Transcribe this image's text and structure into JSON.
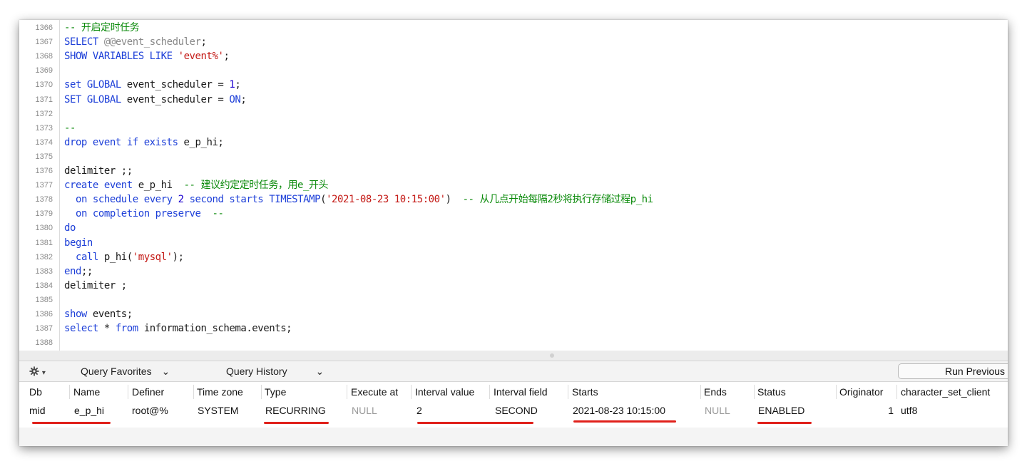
{
  "editor": {
    "lines": [
      {
        "n": "1366",
        "segs": [
          {
            "t": "-- 开启定时任务",
            "c": "cm"
          }
        ]
      },
      {
        "n": "1367",
        "segs": [
          {
            "t": "SELECT",
            "c": "kw"
          },
          {
            "t": " "
          },
          {
            "t": "@@event_scheduler",
            "c": "var"
          },
          {
            "t": ";"
          }
        ]
      },
      {
        "n": "1368",
        "segs": [
          {
            "t": "SHOW VARIABLES LIKE",
            "c": "kw"
          },
          {
            "t": " "
          },
          {
            "t": "'event%'",
            "c": "str"
          },
          {
            "t": ";"
          }
        ]
      },
      {
        "n": "1369",
        "segs": []
      },
      {
        "n": "1370",
        "segs": [
          {
            "t": "set",
            "c": "kw"
          },
          {
            "t": " "
          },
          {
            "t": "GLOBAL",
            "c": "kw"
          },
          {
            "t": " event_scheduler = "
          },
          {
            "t": "1",
            "c": "num"
          },
          {
            "t": ";"
          }
        ]
      },
      {
        "n": "1371",
        "segs": [
          {
            "t": "SET",
            "c": "kw"
          },
          {
            "t": " "
          },
          {
            "t": "GLOBAL",
            "c": "kw"
          },
          {
            "t": " event_scheduler = "
          },
          {
            "t": "ON",
            "c": "kw"
          },
          {
            "t": ";"
          }
        ]
      },
      {
        "n": "1372",
        "segs": []
      },
      {
        "n": "1373",
        "segs": [
          {
            "t": "--",
            "c": "cm"
          }
        ]
      },
      {
        "n": "1374",
        "segs": [
          {
            "t": "drop event if exists",
            "c": "kw"
          },
          {
            "t": " e_p_hi;"
          }
        ]
      },
      {
        "n": "1375",
        "segs": []
      },
      {
        "n": "1376",
        "segs": [
          {
            "t": "delimiter ;;"
          }
        ]
      },
      {
        "n": "1377",
        "segs": [
          {
            "t": "create event",
            "c": "kw"
          },
          {
            "t": " e_p_hi  "
          },
          {
            "t": "-- 建议约定定时任务，用e_开头",
            "c": "cm"
          }
        ]
      },
      {
        "n": "1378",
        "segs": [
          {
            "t": "  "
          },
          {
            "t": "on schedule every",
            "c": "kw"
          },
          {
            "t": " "
          },
          {
            "t": "2",
            "c": "num"
          },
          {
            "t": " "
          },
          {
            "t": "second starts TIMESTAMP",
            "c": "kw"
          },
          {
            "t": "("
          },
          {
            "t": "'2021-08-23 10:15:00'",
            "c": "str"
          },
          {
            "t": ")  "
          },
          {
            "t": "-- 从几点开始每隔2秒将执行存储过程p_hi",
            "c": "cm"
          }
        ]
      },
      {
        "n": "1379",
        "segs": [
          {
            "t": "  "
          },
          {
            "t": "on completion preserve",
            "c": "kw"
          },
          {
            "t": "  "
          },
          {
            "t": "--",
            "c": "cm"
          }
        ]
      },
      {
        "n": "1380",
        "segs": [
          {
            "t": "do",
            "c": "kw"
          }
        ]
      },
      {
        "n": "1381",
        "segs": [
          {
            "t": "begin",
            "c": "kw"
          }
        ]
      },
      {
        "n": "1382",
        "segs": [
          {
            "t": "  "
          },
          {
            "t": "call",
            "c": "kw"
          },
          {
            "t": " p_hi("
          },
          {
            "t": "'mysql'",
            "c": "str"
          },
          {
            "t": ");"
          }
        ]
      },
      {
        "n": "1383",
        "segs": [
          {
            "t": "end",
            "c": "kw"
          },
          {
            "t": ";;"
          }
        ]
      },
      {
        "n": "1384",
        "segs": [
          {
            "t": "delimiter ;"
          }
        ]
      },
      {
        "n": "1385",
        "segs": []
      },
      {
        "n": "1386",
        "segs": [
          {
            "t": "show",
            "c": "kw"
          },
          {
            "t": " events;"
          }
        ]
      },
      {
        "n": "1387",
        "segs": [
          {
            "t": "select",
            "c": "kw"
          },
          {
            "t": " * "
          },
          {
            "t": "from",
            "c": "kw"
          },
          {
            "t": " information_schema.events;"
          }
        ]
      },
      {
        "n": "1388",
        "segs": []
      }
    ]
  },
  "toolbar": {
    "gear_icon": "gear-icon",
    "gear_caret": "▾",
    "query_favorites": "Query Favorites",
    "query_history": "Query History",
    "dropdown_glyph": "⌄",
    "run_previous": "Run Previous"
  },
  "results": {
    "columns": [
      "Db",
      "Name",
      "Definer",
      "Time zone",
      "Type",
      "Execute at",
      "Interval value",
      "Interval field",
      "Starts",
      "Ends",
      "Status",
      "Originator",
      "character_set_client"
    ],
    "row": [
      "mid",
      "e_p_hi",
      "root@%",
      "SYSTEM",
      "RECURRING",
      "NULL",
      "2",
      "SECOND",
      "2021-08-23 10:15:00",
      "NULL",
      "ENABLED",
      "1",
      "utf8"
    ]
  },
  "colors": {
    "keyword": "#1d3fd8",
    "string": "#c41a16",
    "comment": "#0a8a0a",
    "number": "#1c00cf",
    "annotation": "#e0201a"
  }
}
